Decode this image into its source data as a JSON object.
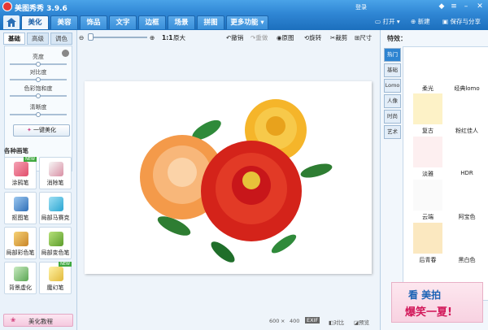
{
  "app": {
    "title": "美图秀秀 3.9.6",
    "login": "登录"
  },
  "tabs": [
    "美化",
    "美容",
    "饰品",
    "文字",
    "边框",
    "场景",
    "拼图",
    "更多功能 ▾"
  ],
  "toolbar_right": {
    "open": "打开",
    "new": "新建",
    "save": "保存与分享"
  },
  "left": {
    "subtabs": [
      "基础",
      "高级",
      "调色"
    ],
    "adjust": [
      "亮度",
      "对比度",
      "色彩饱和度",
      "清晰度"
    ],
    "auto_beautify": "一键美化",
    "section_title": "各种画笔",
    "tools": [
      {
        "label": "涂鸦笔",
        "new": "NEW"
      },
      {
        "label": "消除笔"
      },
      {
        "label": "抠图笔"
      },
      {
        "label": "局部马赛克"
      },
      {
        "label": "局部彩色笔"
      },
      {
        "label": "局部变色笔"
      },
      {
        "label": "背景虚化"
      },
      {
        "label": "魔幻笔",
        "new": "NEW"
      }
    ],
    "tutorial": "美化教程"
  },
  "center": {
    "zoom_ratio": "1:1",
    "zoom_original": "原大",
    "tools": [
      "撤销",
      "重做",
      "原图",
      "旋转",
      "裁剪",
      "尺寸"
    ],
    "status": {
      "w": "600",
      "x": "×",
      "h": "400",
      "exif": "EXIF",
      "compare": "对比",
      "preview": "预览"
    }
  },
  "right": {
    "title": "特效：",
    "categories": [
      "热门",
      "基础",
      "Lomo",
      "人像",
      "时尚",
      "艺术"
    ],
    "effects": [
      {
        "label": "柔光",
        "color": "#ffffff"
      },
      {
        "label": "经典lomo",
        "color": "#ffffff"
      },
      {
        "label": "复古",
        "color": "#fdf2c7"
      },
      {
        "label": "粉红佳人",
        "color": "#ffffff"
      },
      {
        "label": "淡雅",
        "color": "#fdeff0"
      },
      {
        "label": "HDR",
        "color": "#ffffff"
      },
      {
        "label": "云端",
        "color": "#fafafa"
      },
      {
        "label": "阿宝色",
        "color": "#ffffff"
      },
      {
        "label": "后青春",
        "color": "#fbe8c0"
      },
      {
        "label": "黑白色",
        "color": "#ffffff"
      }
    ],
    "banner": {
      "line1": "看 美拍",
      "line2": "爆笑一夏!"
    }
  },
  "colors": {
    "accent": "#2e84d1",
    "title_bar": "#3a93dd"
  }
}
